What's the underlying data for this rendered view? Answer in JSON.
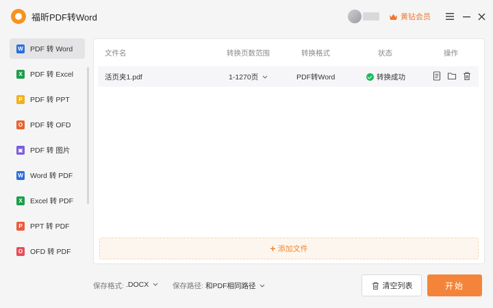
{
  "app": {
    "title": "福昕PDF转Word",
    "vip_label": "黄钻会员"
  },
  "sidebar": {
    "items": [
      {
        "label": "PDF 转 Word",
        "icon": "word-icon",
        "color": "#2b6fdc",
        "glyph": "W"
      },
      {
        "label": "PDF 转 Excel",
        "icon": "excel-icon",
        "color": "#1e9e4a",
        "glyph": "X"
      },
      {
        "label": "PDF 转 PPT",
        "icon": "ppt-icon",
        "color": "#f0b021",
        "glyph": "P"
      },
      {
        "label": "PDF 转 OFD",
        "icon": "ofd-icon",
        "color": "#e8622c",
        "glyph": "O"
      },
      {
        "label": "PDF 转 图片",
        "icon": "image-icon",
        "color": "#7b5ce0",
        "glyph": "▣"
      },
      {
        "label": "Word 转 PDF",
        "icon": "word-to-pdf-icon",
        "color": "#2b6fdc",
        "glyph": "W"
      },
      {
        "label": "Excel 转 PDF",
        "icon": "excel-to-pdf-icon",
        "color": "#1e9e4a",
        "glyph": "X"
      },
      {
        "label": "PPT 转 PDF",
        "icon": "ppt-to-pdf-icon",
        "color": "#ef5a3c",
        "glyph": "P"
      },
      {
        "label": "OFD 转 PDF",
        "icon": "ofd-to-pdf-icon",
        "color": "#ea4b5a",
        "glyph": "O"
      }
    ]
  },
  "table": {
    "headers": [
      "文件名",
      "转换页数范围",
      "转换格式",
      "状态",
      "操作"
    ],
    "rows": [
      {
        "filename": "活页夹1.pdf",
        "page_range": "1-1270页",
        "format": "PDF转Word",
        "status": "转换成功"
      }
    ]
  },
  "add_file_label": "添加文件",
  "footer": {
    "format_label": "保存格式:",
    "format_value": ".DOCX",
    "path_label": "保存路径:",
    "path_value": "和PDF相同路径",
    "clear_label": "清空列表",
    "start_label": "开始"
  },
  "colors": {
    "accent": "#f4843a",
    "success": "#21b85b",
    "vip": "#f0762b"
  }
}
